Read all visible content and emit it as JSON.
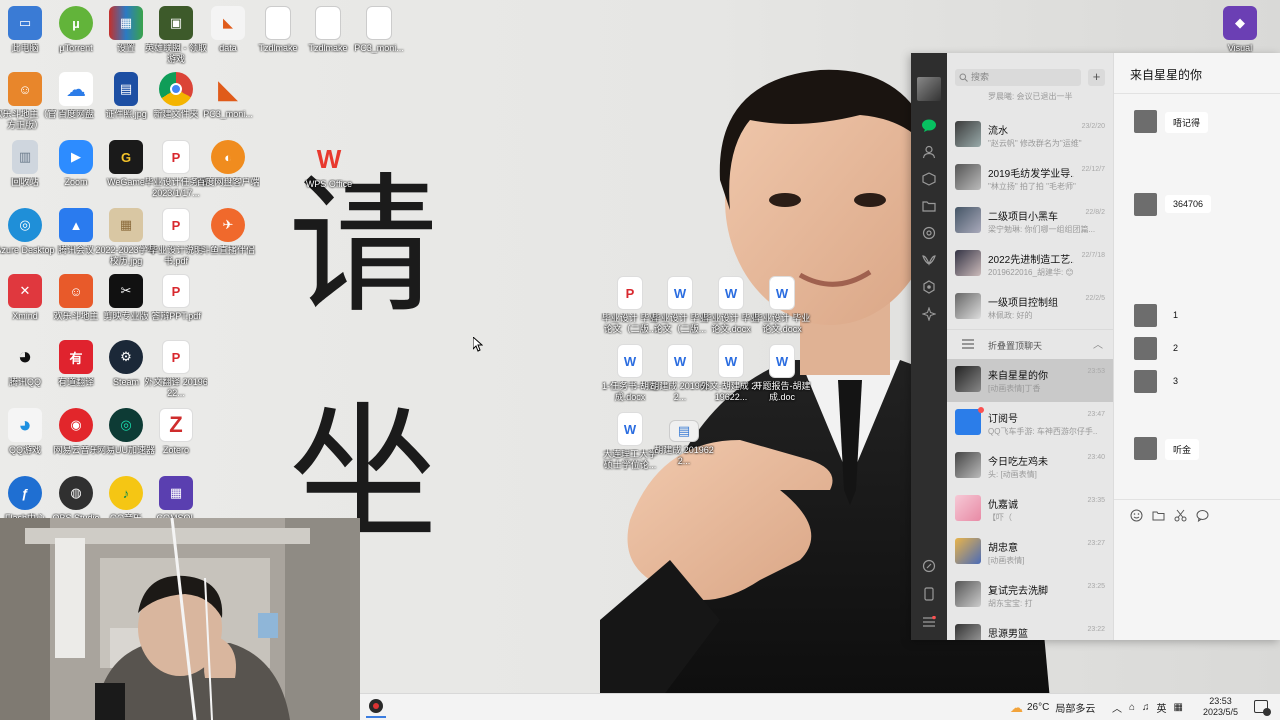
{
  "desktop": {
    "big_chars": [
      "请",
      "坐"
    ],
    "icons": [
      {
        "label": "此电脑",
        "color": "#3a7bd5",
        "glyph": "▭"
      },
      {
        "label": "µTorrent",
        "color": "#62b43a",
        "glyph": "µ"
      },
      {
        "label": "设置",
        "color": "#c4302b",
        "glyph": "▦"
      },
      {
        "label": "英雄联盟 - 领取游戏",
        "color": "#3d5a2a",
        "glyph": "▣"
      },
      {
        "label": "data",
        "color": "#f0f0f0",
        "glyph": "◣"
      },
      {
        "label": "Tzdlmake",
        "color": "#ffffff",
        "glyph": ""
      },
      {
        "label": "Tzdlmake",
        "color": "#ffffff",
        "glyph": ""
      },
      {
        "label": "PC3_moni...",
        "color": "#ffffff",
        "glyph": ""
      },
      {
        "label": "欢乐斗地主（官方正版）",
        "color": "#e8862b",
        "glyph": "☺"
      },
      {
        "label": "百度网盘",
        "color": "#2c7ce8",
        "glyph": "☁"
      },
      {
        "label": "证件照.jpg",
        "color": "#1d4fa3",
        "glyph": "▤"
      },
      {
        "label": "新建文件夹",
        "color": "#f6c343",
        "glyph": "◉"
      },
      {
        "label": "PC3_moni...",
        "color": "#e05b1a",
        "glyph": "◣"
      },
      {
        "label": "回收站",
        "color": "#cfd6de",
        "glyph": "▥"
      },
      {
        "label": "Zoom",
        "color": "#2d8cff",
        "glyph": "▶"
      },
      {
        "label": "WeGame",
        "color": "#1a1a1a",
        "glyph": "G"
      },
      {
        "label": "毕业设计任务书 2023/1/17...",
        "color": "#d8282e",
        "glyph": "P"
      },
      {
        "label": "百度网盘客户端",
        "color": "#f08c1e",
        "glyph": "◐"
      },
      {
        "label": "Azure Desktop",
        "color": "#1f8fd8",
        "glyph": "◎"
      },
      {
        "label": "腾讯会议",
        "color": "#2a7bef",
        "glyph": "▲"
      },
      {
        "label": "2022-2023学年校历.jpg",
        "color": "#d9c7a3",
        "glyph": "▦"
      },
      {
        "label": "毕业设计说明书.pdf",
        "color": "#d8282e",
        "glyph": "P"
      },
      {
        "label": "斗鱼直播伴侣",
        "color": "#f0692c",
        "glyph": "✈"
      },
      {
        "label": "Xmind",
        "color": "#e0383e",
        "glyph": "✕"
      },
      {
        "label": "欢乐斗地主",
        "color": "#e85a2a",
        "glyph": "☺"
      },
      {
        "label": "剪映专业版",
        "color": "#111111",
        "glyph": "✂"
      },
      {
        "label": "答辩PPT.pdf",
        "color": "#d8282e",
        "glyph": "P"
      },
      {
        "label": "腾讯QQ",
        "color": "#111111",
        "glyph": "◕"
      },
      {
        "label": "有道翻译",
        "color": "#e0232e",
        "glyph": "有"
      },
      {
        "label": "Steam",
        "color": "#1b2838",
        "glyph": "⚙"
      },
      {
        "label": "外文翻译 2019622...",
        "color": "#d8282e",
        "glyph": "P"
      },
      {
        "label": "QQ游戏",
        "color": "#f5f5f5",
        "glyph": "◕"
      },
      {
        "label": "网易云音乐",
        "color": "#e2262b",
        "glyph": "◉"
      },
      {
        "label": "网易UU加速器",
        "color": "#1aa68f",
        "glyph": "◎"
      },
      {
        "label": "Zotero",
        "color": "#cf2d2d",
        "glyph": "Z"
      },
      {
        "label": "Flash中心",
        "color": "#1f6fd2",
        "glyph": "ƒ"
      },
      {
        "label": "OBS Studio",
        "color": "#303030",
        "glyph": "◍"
      },
      {
        "label": "QQ音乐",
        "color": "#f5c614",
        "glyph": "♪"
      },
      {
        "label": "COMSOL",
        "color": "#5a3fb0",
        "glyph": "▦"
      },
      {
        "label": "WPS Office",
        "color": "#e8392f",
        "glyph": "W"
      },
      {
        "label": "Visual",
        "color": "#6b3fb4",
        "glyph": "◆"
      }
    ],
    "files": [
      {
        "label": "毕业设计 毕业论文（二版...",
        "color": "#d8282e",
        "glyph": "P"
      },
      {
        "label": "毕业设计 毕业论文（二版...",
        "color": "#2b6de0",
        "glyph": "W"
      },
      {
        "label": "毕业设计 毕业论文.docx",
        "color": "#2b6de0",
        "glyph": "W"
      },
      {
        "label": "毕业设计 毕业论文.docx",
        "color": "#2b6de0",
        "glyph": "W"
      },
      {
        "label": "1-任务书-胡建成.docx",
        "color": "#2b6de0",
        "glyph": "W"
      },
      {
        "label": "胡建成 2019622...",
        "color": "#2b6de0",
        "glyph": "W"
      },
      {
        "label": "外文-胡建成 2019622...",
        "color": "#2b6de0",
        "glyph": "W"
      },
      {
        "label": "开题报告-胡建成.doc",
        "color": "#2b6de0",
        "glyph": "W"
      },
      {
        "label": "大连理工大学 硕士学位论...",
        "color": "#2b6de0",
        "glyph": "W"
      },
      {
        "label": "胡建成 2019622...",
        "color": "#f0f0f0",
        "glyph": "▤"
      }
    ]
  },
  "wechat": {
    "search_placeholder": "搜索",
    "plus": "+",
    "conversation_title": "来自星星的你",
    "chats": [
      {
        "name": "",
        "preview": "罗晨曦: 会议已退出一半",
        "time": ""
      },
      {
        "name": "流水",
        "preview": "\"赵云帆\" 修改群名为\"运维\"",
        "time": "23/2/20"
      },
      {
        "name": "2019毛纺发学业导...",
        "preview": "\"林立扬\" 拍了拍 \"毛老师\"",
        "time": "22/12/7"
      },
      {
        "name": "二级项目小黑车",
        "preview": "梁宁勉琳: 你们哪一组组团篇...",
        "time": "22/8/2"
      },
      {
        "name": "2022先进制造工艺...",
        "preview": "2019622016_胡建华: 😊",
        "time": "22/7/18"
      },
      {
        "name": "一级项目控制组",
        "preview": "林佩政: 好的",
        "time": "22/2/5"
      },
      {
        "name": "折叠置顶聊天",
        "preview": "",
        "time": ""
      },
      {
        "name": "来自星星的你",
        "preview": "[动画表情]丁香",
        "time": "23:53"
      },
      {
        "name": "订阅号",
        "preview": "QQ飞车手游: 车神西游尔仔手...",
        "time": "23:47"
      },
      {
        "name": "今日吃左鸡未",
        "preview": "头: [动画表情]",
        "time": "23:40"
      },
      {
        "name": "仇嘉诚",
        "preview": "【吓（",
        "time": "23:35"
      },
      {
        "name": "胡忠意",
        "preview": "[动画表情]",
        "time": "23:27"
      },
      {
        "name": "复试完去洗脚",
        "preview": "胡东宝宝: 打",
        "time": "23:25"
      },
      {
        "name": "思源男篮",
        "preview": "",
        "time": "23:22"
      }
    ],
    "messages": [
      "唔记得",
      "364706",
      "1",
      "2",
      "3",
      "听金"
    ]
  },
  "taskbar": {
    "weather_temp": "26°C",
    "weather_desc": "局部多云",
    "tray_chevron": "︿",
    "ime": "英",
    "clock_time": "23:53",
    "clock_date": "2023/5/5"
  }
}
